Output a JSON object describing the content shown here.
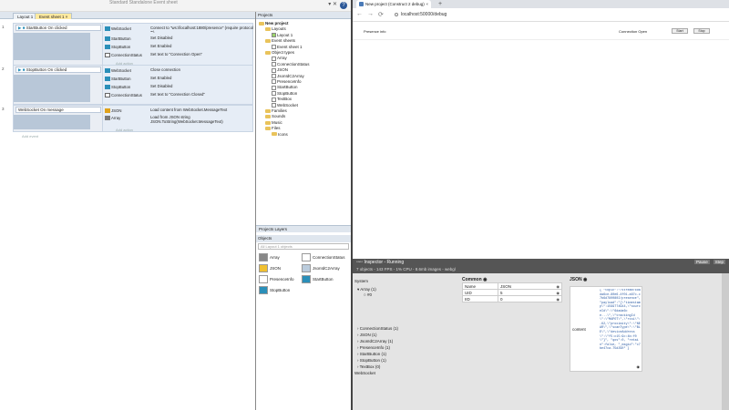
{
  "ide": {
    "top_dim": "Standard   Standalone   Event sheet",
    "tabs": [
      "Layout 1",
      "Event sheet 1"
    ],
    "events": [
      {
        "num": "1",
        "condition": "StartButton   On clicked",
        "actions": [
          {
            "obj": "WebSocket",
            "color": "#2a8fb9",
            "text": "Connect to \"ws://localhost:1880/presence\"  (require protocol \"\")"
          },
          {
            "obj": "StartButton",
            "color": "#2a8fb9",
            "text": "Set Disabled"
          },
          {
            "obj": "StopButton",
            "color": "#2a8fb9",
            "text": "Set Enabled"
          },
          {
            "obj": "ConnectionStatus",
            "color": "#2a8fb9",
            "text": "Set text to \"Connection Open\""
          }
        ]
      },
      {
        "num": "2",
        "condition": "StopButton   On clicked",
        "actions": [
          {
            "obj": "WebSocket",
            "color": "#2a8fb9",
            "text": "Close connection"
          },
          {
            "obj": "StartButton",
            "color": "#2a8fb9",
            "text": "Set Enabled"
          },
          {
            "obj": "StopButton",
            "color": "#2a8fb9",
            "text": "Set Disabled"
          },
          {
            "obj": "ConnectionStatus",
            "color": "#2a8fb9",
            "text": "Set text to \"Connection Closed\""
          }
        ]
      },
      {
        "num": "3",
        "condition": "WebSocket   On message",
        "actions": [
          {
            "obj": "JSON",
            "color": "#e0a21b",
            "text": "Load content from WebSocket.MessageText"
          },
          {
            "obj": "Array",
            "color": "#7a7a7a",
            "text": "Load from JSON string JSON.ToString(WebSocket.MessageText)"
          }
        ]
      }
    ],
    "add_action": "Add action",
    "add_event": "Add event"
  },
  "projects": {
    "header": "Projects",
    "tree": [
      {
        "label": "New project",
        "indent": 0,
        "kind": "root"
      },
      {
        "label": "Layouts",
        "indent": 1,
        "kind": "folder"
      },
      {
        "label": "Layout 1",
        "indent": 2,
        "kind": "layout"
      },
      {
        "label": "Event sheets",
        "indent": 1,
        "kind": "folder"
      },
      {
        "label": "Event sheet 1",
        "indent": 2,
        "kind": "sheet"
      },
      {
        "label": "Object types",
        "indent": 1,
        "kind": "folder"
      },
      {
        "label": "Array",
        "indent": 2,
        "kind": "obj"
      },
      {
        "label": "ConnectionStatus",
        "indent": 2,
        "kind": "obj"
      },
      {
        "label": "JSON",
        "indent": 2,
        "kind": "obj"
      },
      {
        "label": "JsonIdC2Array",
        "indent": 2,
        "kind": "obj"
      },
      {
        "label": "PresenceInfo",
        "indent": 2,
        "kind": "obj"
      },
      {
        "label": "StartButton",
        "indent": 2,
        "kind": "obj"
      },
      {
        "label": "StopButton",
        "indent": 2,
        "kind": "obj"
      },
      {
        "label": "TextBox",
        "indent": 2,
        "kind": "obj"
      },
      {
        "label": "WebSocket",
        "indent": 2,
        "kind": "obj"
      },
      {
        "label": "Families",
        "indent": 1,
        "kind": "folder"
      },
      {
        "label": "Sounds",
        "indent": 1,
        "kind": "folder"
      },
      {
        "label": "Music",
        "indent": 1,
        "kind": "folder"
      },
      {
        "label": "Files",
        "indent": 1,
        "kind": "folder"
      },
      {
        "label": "Icons",
        "indent": 2,
        "kind": "folder"
      }
    ],
    "tabs": "Projects   Layers"
  },
  "objects": {
    "header": "Objects",
    "filter": "All Layout 1 objects",
    "items": [
      {
        "label": "Array",
        "color": "#888"
      },
      {
        "label": "ConnectionStatus",
        "color": "#fff"
      },
      {
        "label": "JSON",
        "color": "#f0c030"
      },
      {
        "label": "JsonIdC2Array",
        "color": "#bcd"
      },
      {
        "label": "PresenceInfo",
        "color": "#fff"
      },
      {
        "label": "StartButton",
        "color": "#2a8fb9"
      },
      {
        "label": "StopButton",
        "color": "#2a8fb9"
      }
    ]
  },
  "browser": {
    "tab_title": "New project (Construct 2 debug)",
    "url": "localhost:50000/debug",
    "presence_label": "Presence info",
    "connection_status": "Connection Open",
    "start_btn": "Start",
    "stop_btn": "Stop"
  },
  "inspector": {
    "title": "Inspector - Running",
    "stats": "7 objects - 143 FPS - 1% CPU - 8.6mb images - webgl",
    "pause": "Pause",
    "step": "Step",
    "system_list": [
      "System",
      "Array (1)",
      "#0",
      "ConnectionStatus (1)",
      "JSON (1)",
      "JsonIdC2Array (1)",
      "PresenceInfo (1)",
      "StartButton (1)",
      "StopButton (1)",
      "TextBox (0)",
      "WebSocket"
    ],
    "common_header": "Common",
    "common_rows": [
      {
        "k": "Name",
        "v": "JSON"
      },
      {
        "k": "UID",
        "v": "5"
      },
      {
        "k": "IID",
        "v": "0"
      }
    ],
    "json_header": "JSON",
    "json_label": "content",
    "json_text": "{\n\"topic\":\"/stream/6dada6ce-80e6-4f01-a67c-c7b6d7800802/presence\",\n\"payload\":\"{\\\"timestamp\\\":1599774944,\\\"sourceId\\\":\\\"6dada6ce...\\\",\\\"trackingId\\\":\\\"MAPOT\\\",\\\"rssi\\\":-62,\\\"proximity\\\":\\\"NEAR\\\",\\\"scanType\\\":\\\"BLE\\\",\\\"deviceAddress\\\":\\\"f5:c15:9c:4b:f0\\\"}\",\n\"qos\":0,\n\"retain\":false,\n\"_msgid\":\"c7be47ca.75d290\"\n}"
  }
}
